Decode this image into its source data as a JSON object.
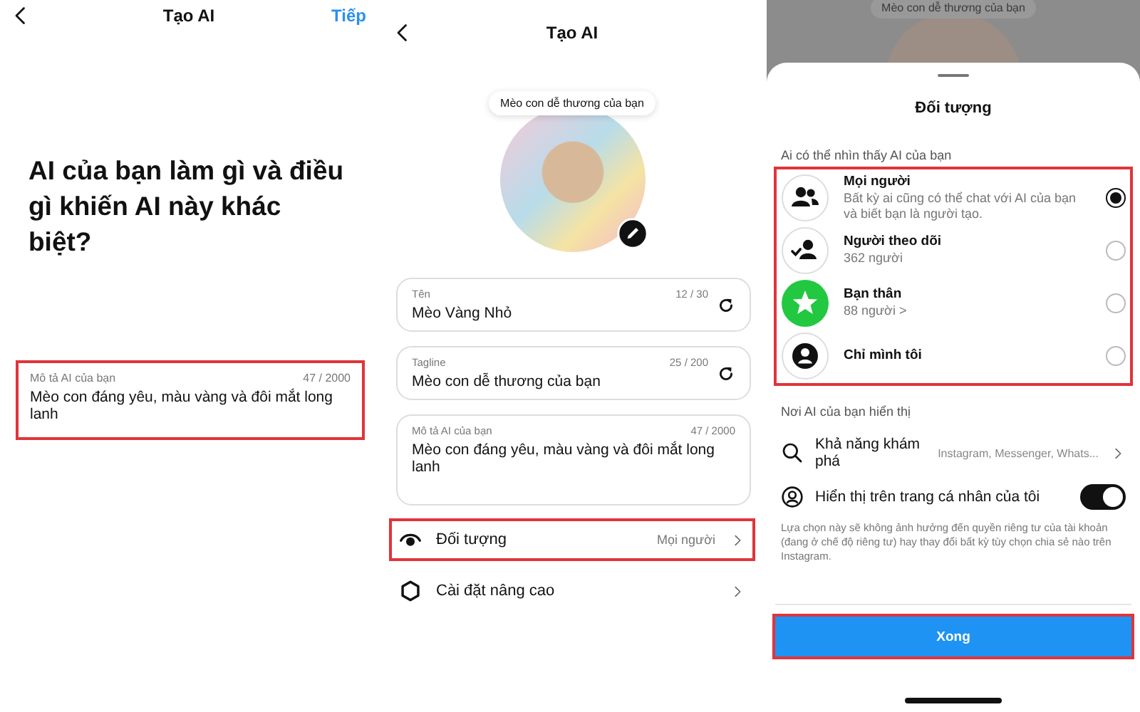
{
  "screen_describe": {
    "title": "Tạo AI",
    "action": "Tiếp",
    "heading": "AI của bạn làm gì và điều gì khiến AI này khác biệt?",
    "description_field": {
      "label": "Mô tả AI của bạn",
      "counter": "47 / 2000",
      "value": "Mèo con đáng yêu, màu vàng và đôi mắt long lanh",
      "highlighted": true
    }
  },
  "screen_edit": {
    "title": "Tạo AI",
    "tooltip": "Mèo con dễ thương của bạn",
    "fields": [
      {
        "kind": "regenerate",
        "label": "Tên",
        "counter": "12 / 30",
        "value": "Mèo Vàng Nhỏ"
      },
      {
        "kind": "regenerate",
        "label": "Tagline",
        "counter": "25 / 200",
        "value": "Mèo con dễ thương của bạn"
      },
      {
        "kind": "multiline",
        "label": "Mô tả AI của bạn",
        "counter": "47 / 2000",
        "value": "Mèo con đáng yêu, màu vàng và đôi mắt long lanh"
      }
    ],
    "settings": [
      {
        "kind": "audience",
        "label": "Đối tượng",
        "value": "Mọi người",
        "highlighted": true
      },
      {
        "kind": "advanced",
        "label": "Cài đặt nâng cao",
        "highlighted": false
      }
    ]
  },
  "screen_audience": {
    "background_tooltip": "Mèo con dễ thương của bạn",
    "title": "Đối tượng",
    "section_title": "Ai có thể nhìn thấy AI của bạn",
    "options_highlighted": true,
    "options": [
      {
        "kind": "everyone",
        "label": "Mọi người",
        "subtitle": "Bất kỳ ai cũng có thể chat với AI của bạn và biết bạn là người tạo.",
        "selected": true
      },
      {
        "kind": "followers",
        "label": "Người theo dõi",
        "subtitle": "362 người",
        "selected": false
      },
      {
        "kind": "close_friends",
        "label": "Bạn thân",
        "subtitle": "88 người >",
        "selected": false
      },
      {
        "kind": "only_me",
        "label": "Chỉ mình tôi",
        "selected": false
      }
    ],
    "placement_title": "Nơi AI của bạn hiển thị",
    "discovery": {
      "label": "Khả năng khám phá",
      "value": "Instagram, Messenger, Whats..."
    },
    "profile_toggle": {
      "label": "Hiển thị trên trang cá nhân của tôi",
      "on": true
    },
    "note": "Lựa chọn này sẽ không ảnh hưởng đến quyền riêng tư của tài khoản (đang ở chế độ riêng tư) hay thay đổi bất kỳ tùy chọn chia sẻ nào trên Instagram.",
    "done_button": {
      "label": "Xong",
      "highlighted": true
    }
  }
}
